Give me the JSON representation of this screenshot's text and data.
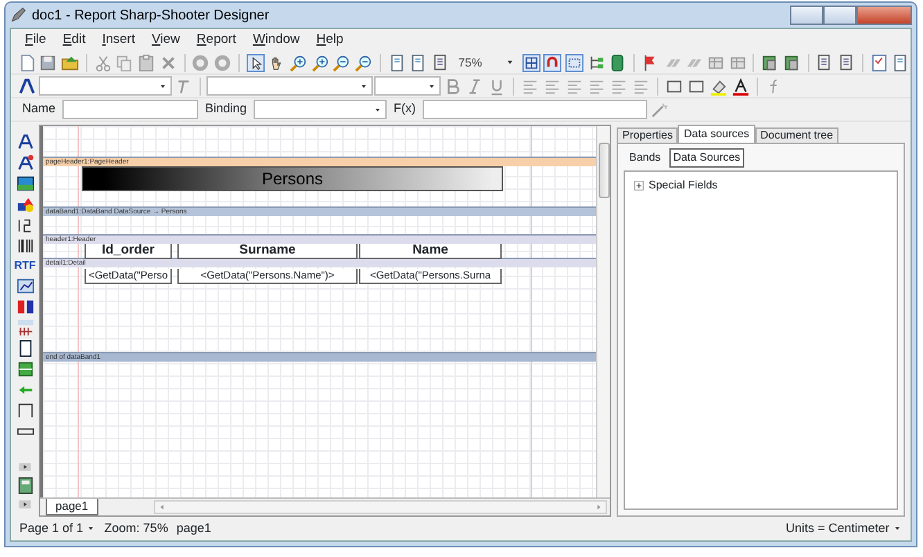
{
  "window": {
    "title": "doc1 - Report Sharp-Shooter Designer"
  },
  "menu": [
    {
      "label": "File"
    },
    {
      "label": "Edit"
    },
    {
      "label": "Insert"
    },
    {
      "label": "View"
    },
    {
      "label": "Report"
    },
    {
      "label": "Window"
    },
    {
      "label": "Help"
    }
  ],
  "toolbar": {
    "zoom": "75%"
  },
  "property_bar": {
    "name_label": "Name",
    "binding_label": "Binding",
    "formula_label": "F(x)"
  },
  "toolbox": [
    {
      "kind": "text",
      "label": "RTF"
    }
  ],
  "bands": [
    {
      "caption": "pageHeader1:PageHeader",
      "color": "#f7cfa8"
    },
    {
      "caption": "dataBand1:DataBand  DataSource  →  Persons",
      "color": "#b4c3d8"
    },
    {
      "caption": "header1:Header",
      "color": "#dcdcec"
    },
    {
      "caption": "detail1:Detail",
      "color": "#dcdcec"
    },
    {
      "caption": "end of dataBand1",
      "color": "#a8b8d0"
    }
  ],
  "report_title": "Persons",
  "header_cells": [
    "Id_order",
    "Surname",
    "Name"
  ],
  "detail_cells": [
    "<GetData(\"Perso",
    "<GetData(\"Persons.Name\")>",
    "<GetData(\"Persons.Surna"
  ],
  "page_tabs": [
    {
      "label": "page1",
      "selected": true
    }
  ],
  "panel": {
    "tabs": [
      {
        "label": "Properties",
        "selected": false
      },
      {
        "label": "Data sources",
        "selected": true
      },
      {
        "label": "Document tree",
        "selected": false
      }
    ],
    "subtabs": [
      {
        "label": "Bands",
        "selected": false
      },
      {
        "label": "Data Sources",
        "selected": true
      }
    ],
    "tree": [
      {
        "label": "Special Fields",
        "expanded": false
      }
    ]
  },
  "status_bar": {
    "page": "Page 1 of 1",
    "zoom": "Zoom: 75%",
    "page_name": "page1",
    "units": "Units = Centimeter"
  }
}
